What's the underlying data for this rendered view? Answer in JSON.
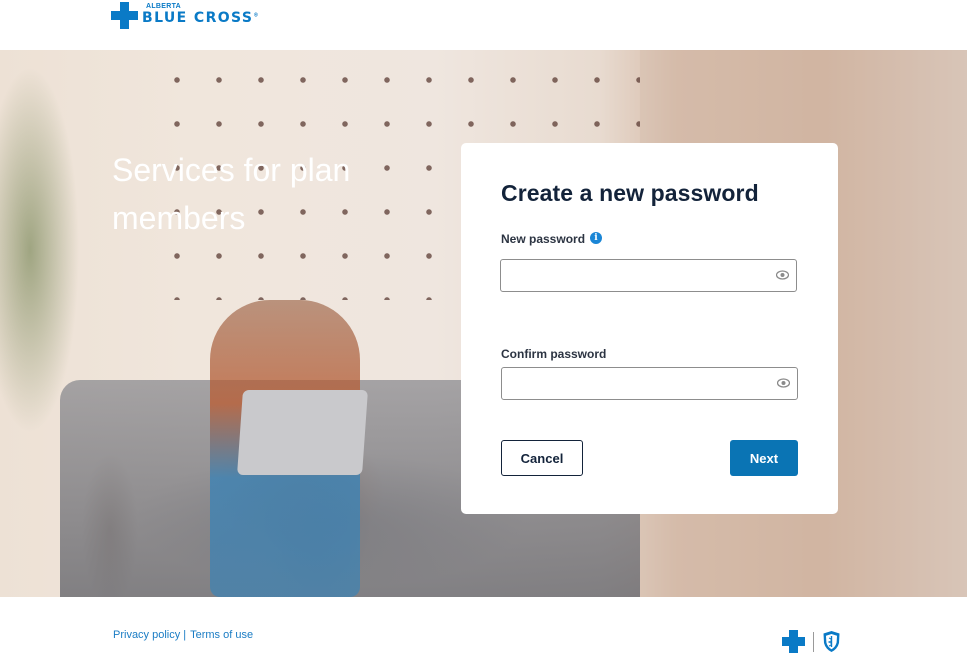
{
  "header": {
    "logo": {
      "small_text": "ALBERTA",
      "big_text": "BLUE CROSS",
      "registered": "®",
      "icon": "blue-cross-icon"
    }
  },
  "hero": {
    "title": "Services for plan members"
  },
  "card": {
    "title": "Create a new password",
    "new_password": {
      "label": "New password",
      "info_icon": "info-icon",
      "info_glyph": "i",
      "value": "",
      "placeholder": "",
      "toggle_icon": "eye-icon"
    },
    "confirm_password": {
      "label": "Confirm password",
      "value": "",
      "placeholder": "",
      "toggle_icon": "eye-icon"
    },
    "cancel_label": "Cancel",
    "next_label": "Next"
  },
  "footer": {
    "privacy_label": "Privacy policy",
    "separator": "|",
    "terms_label": "Terms of use",
    "logos": [
      "blue-cross-icon",
      "blue-shield-icon"
    ]
  },
  "colors": {
    "brand_blue": "#0a7ac6",
    "primary_button": "#0a74b4",
    "heading_navy": "#13233a",
    "link_blue": "#1a7cc4"
  }
}
